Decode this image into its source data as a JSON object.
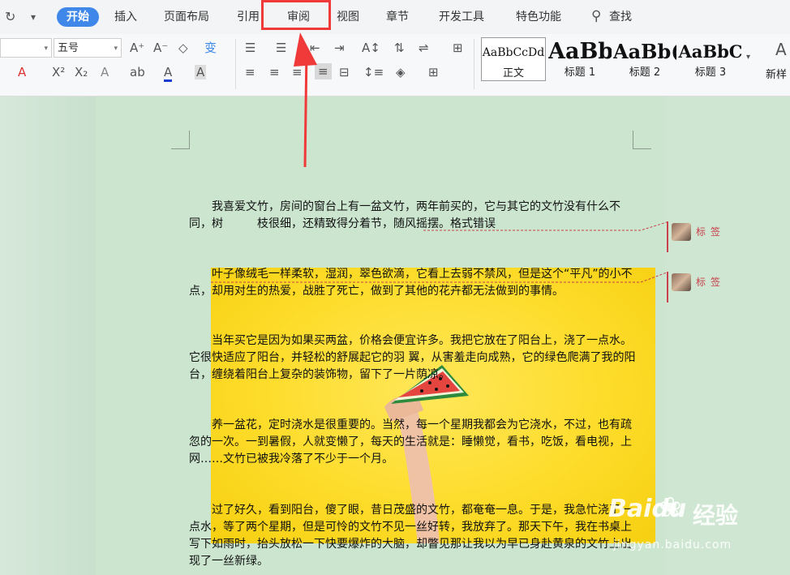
{
  "menu": {
    "items": [
      "开始",
      "插入",
      "页面布局",
      "引用",
      "审阅",
      "视图",
      "章节",
      "开发工具",
      "特色功能"
    ],
    "search_label": "查找"
  },
  "ribbon": {
    "font_name": "",
    "font_size": "五号",
    "styles": [
      {
        "sample": "AaBbCcDd",
        "name": "正文"
      },
      {
        "sample": "AaBb",
        "name": "标题 1"
      },
      {
        "sample": "AaBb(",
        "name": "标题 2"
      },
      {
        "sample": "AaBbC",
        "name": "标题 3"
      }
    ],
    "new_style_label": "新样"
  },
  "document": {
    "paragraphs": [
      "我喜爱文竹，房间的窗台上有一盆文竹，两年前买的，它与其它的文竹没有什么不同，树　　　枝很细，还精致得分着节，随风摇摆。格式错误",
      "叶子像绒毛一样柔软，湿润，翠色欲滴，它看上去弱不禁风，但是这个“平凡”的小不点，却用对生的热爱，战胜了死亡，做到了其他的花卉都无法做到的事情。",
      "当年买它是因为如果买两盆，价格会便宜许多。我把它放在了阳台上，浇了一点水。它很快适应了阳台，并轻松的舒展起它的羽 翼，从害羞走向成熟，它的绿色爬满了我的阳台，缠绕着阳台上复杂的装饰物，留下了一片荫凉。",
      "养一盆花，定时浇水是很重要的。当然，每一个星期我都会为它浇水，不过，也有疏忽的一次。一到暑假，人就变懒了，每天的生活就是：睡懒觉，看书，吃饭，看电视，上网……文竹已被我冷落了不少于一个月。",
      "过了好久，看到阳台，傻了眼，昔日茂盛的文竹，都奄奄一息。于是，我急忙浇了一点水，等了两个星期，但是可怜的文竹不见一丝好转，我放弃了。那天下午，我在书桌上写下如雨时，抬头放松一下快要爆炸的大脑，却瞥见那让我以为早已身赴黄泉的文竹上出现了一丝新绿。"
    ]
  },
  "comments": [
    {
      "label": "标签"
    },
    {
      "label": "标签"
    }
  ],
  "watermark": {
    "brand": "Baidu",
    "brand_cn": "经验",
    "url": "jingyan.baidu.com"
  },
  "colors": {
    "accent": "#3f87e8",
    "highlight_box": "#f03a3a",
    "comment": "#c8414b"
  }
}
